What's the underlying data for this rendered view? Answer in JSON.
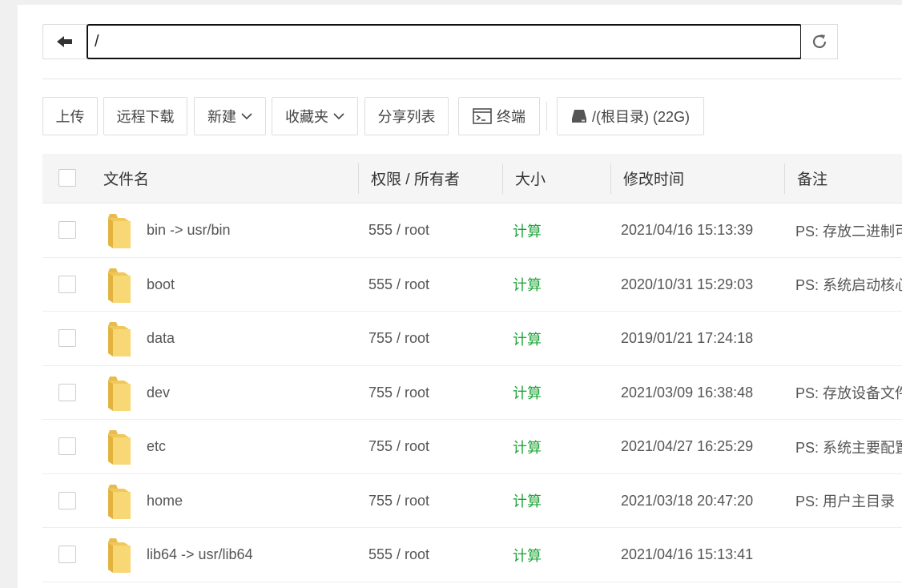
{
  "path_bar": {
    "path_value": "/",
    "back_icon": "arrow-left-icon",
    "refresh_icon": "refresh-icon"
  },
  "toolbar": {
    "upload": "上传",
    "remote_download": "远程下载",
    "new": "新建",
    "favorites": "收藏夹",
    "share_list": "分享列表",
    "terminal": "终端",
    "disk": "/(根目录) (22G)"
  },
  "table": {
    "headers": {
      "name": "文件名",
      "permission": "权限 / 所有者",
      "size": "大小",
      "modified": "修改时间",
      "remark": "备注"
    },
    "rows": [
      {
        "name": "bin -> usr/bin",
        "permission": "555 / root",
        "size": "计算",
        "modified": "2021/04/16 15:13:39",
        "remark": "PS: 存放二进制可"
      },
      {
        "name": "boot",
        "permission": "555 / root",
        "size": "计算",
        "modified": "2020/10/31 15:29:03",
        "remark": "PS: 系统启动核心"
      },
      {
        "name": "data",
        "permission": "755 / root",
        "size": "计算",
        "modified": "2019/01/21 17:24:18",
        "remark": ""
      },
      {
        "name": "dev",
        "permission": "755 / root",
        "size": "计算",
        "modified": "2021/03/09 16:38:48",
        "remark": "PS: 存放设备文件"
      },
      {
        "name": "etc",
        "permission": "755 / root",
        "size": "计算",
        "modified": "2021/04/27 16:25:29",
        "remark": "PS: 系统主要配置"
      },
      {
        "name": "home",
        "permission": "755 / root",
        "size": "计算",
        "modified": "2021/03/18 20:47:20",
        "remark": "PS: 用户主目录"
      },
      {
        "name": "lib64 -> usr/lib64",
        "permission": "555 / root",
        "size": "计算",
        "modified": "2021/04/16 15:13:41",
        "remark": ""
      }
    ]
  },
  "colors": {
    "accent_green": "#20a53a",
    "folder_yellow": "#f8d775"
  }
}
